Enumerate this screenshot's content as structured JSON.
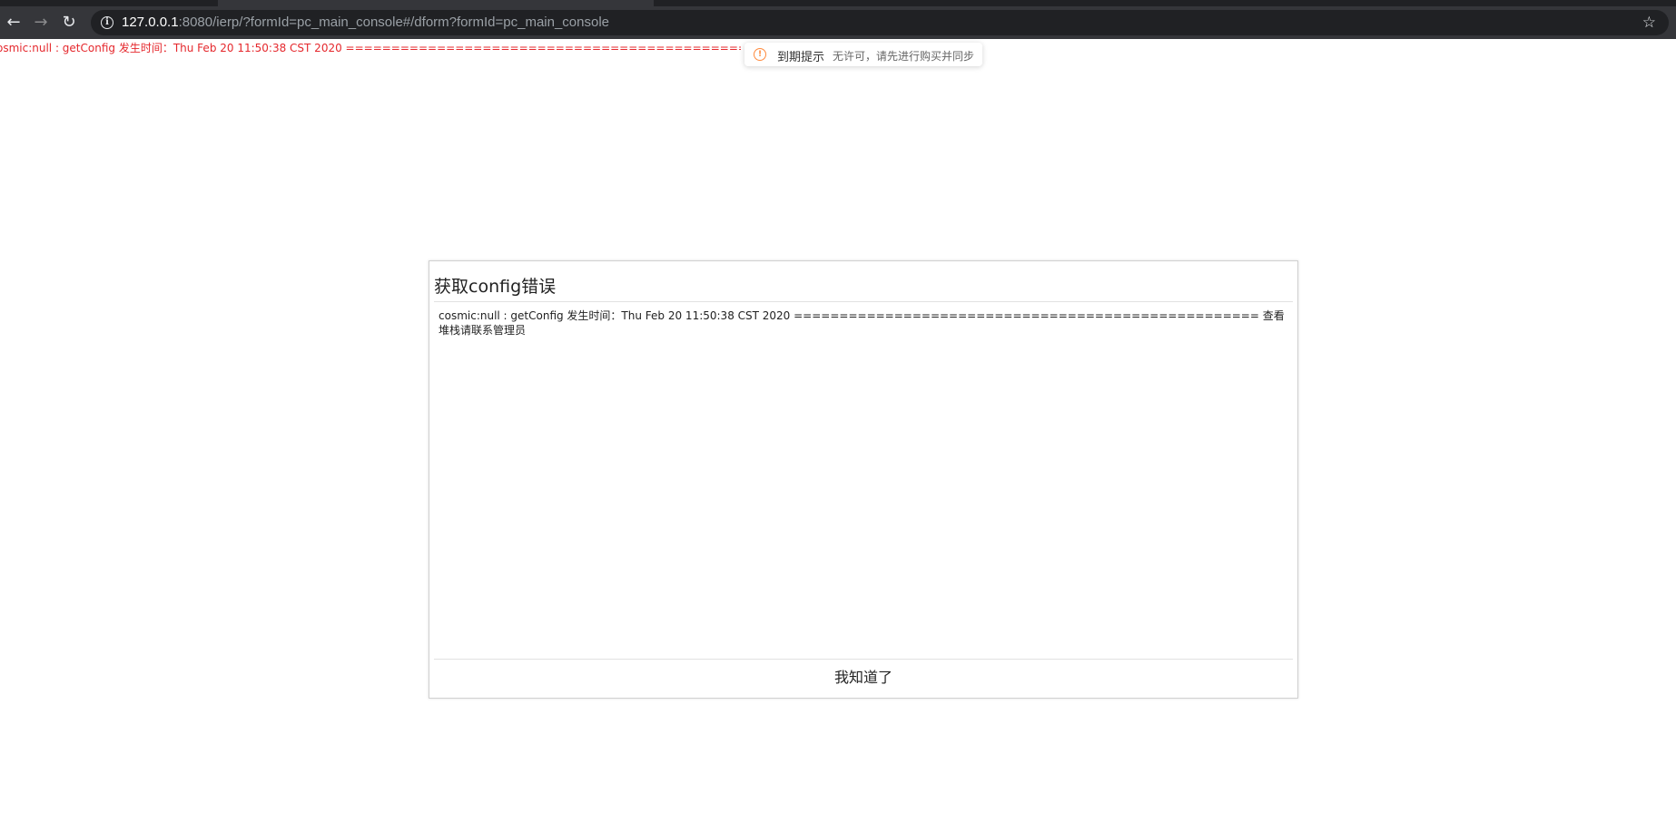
{
  "browser": {
    "url_host": "127.0.0.1",
    "url_rest": ":8080/ierp/?formId=pc_main_console#/dform?formId=pc_main_console"
  },
  "page": {
    "error_line": "osmic:null : getConfig 发生时间：Thu Feb 20 11:50:38 CST 2020 ==================================================================",
    "error_color": "#e5282d"
  },
  "notice": {
    "title": "到期提示",
    "text": "无许可，请先进行购买并同步",
    "icon_color": "#ff8a3d"
  },
  "dialog": {
    "title": "获取config错误",
    "body": "cosmic:null : getConfig 发生时间：Thu Feb 20 11:50:38 CST 2020 =================================================== 查看堆栈请联系管理员",
    "button_label": "我知道了"
  }
}
